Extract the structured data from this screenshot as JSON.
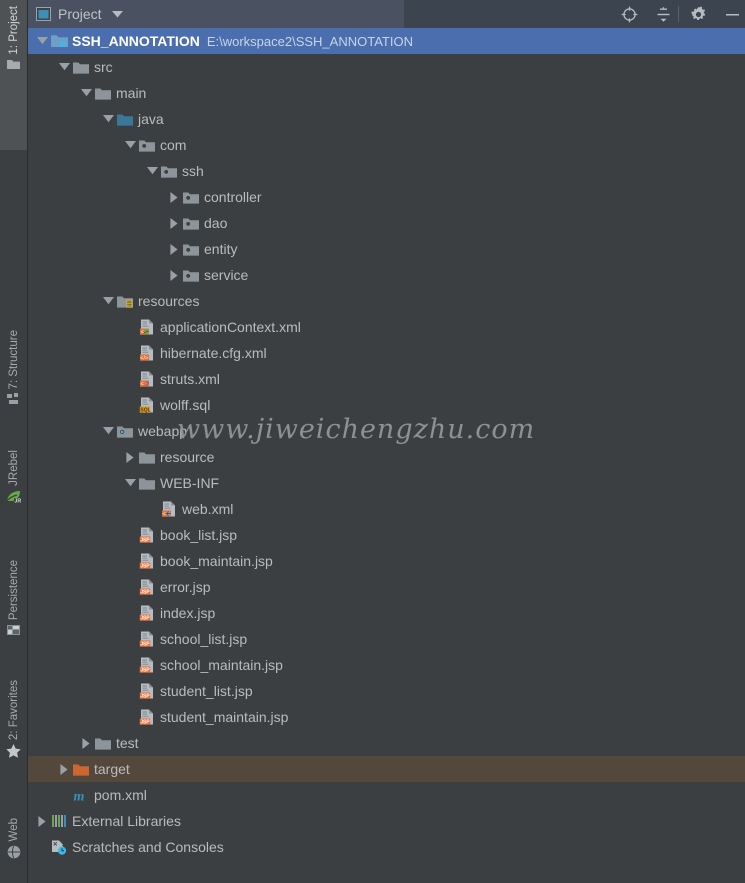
{
  "sidebar": {
    "tabs": [
      {
        "label": "1: Project",
        "icon": "project-folder-icon",
        "selected": true
      },
      {
        "label": "7: Structure",
        "icon": "structure-icon",
        "selected": false
      },
      {
        "label": "JRebel",
        "icon": "jrebel-leaf-icon",
        "selected": false
      },
      {
        "label": "Persistence",
        "icon": "persistence-icon",
        "selected": false
      },
      {
        "label": "2: Favorites",
        "icon": "star-icon",
        "selected": false
      },
      {
        "label": "Web",
        "icon": "web-globe-icon",
        "selected": false
      }
    ]
  },
  "header": {
    "title": "Project",
    "view_icon": "project-view-icon",
    "dropdown_icon": "chevron-down-icon",
    "actions": [
      {
        "name": "scroll-from-source-button",
        "icon": "crosshair-icon"
      },
      {
        "name": "collapse-all-button",
        "icon": "collapse-all-icon"
      },
      {
        "name": "settings-button",
        "icon": "gear-icon"
      },
      {
        "name": "hide-button",
        "icon": "minimize-icon"
      }
    ]
  },
  "colors": {
    "background": "#3c3f41",
    "selection": "#4b6eaf",
    "excluded_row": "#54483c",
    "header_bar": "#3c4450",
    "source_root": "#3b7798",
    "excluded_folder": "#cc6633",
    "text": "#bbbbbb"
  },
  "watermark": "www.jiweichengzhu.com",
  "tree": {
    "rows": [
      {
        "label": "SSH_ANNOTATION",
        "sub": "E:\\workspace2\\SSH_ANNOTATION",
        "depth": 0,
        "arrow": "expanded",
        "icon": "project-module-icon",
        "state": "selected"
      },
      {
        "label": "src",
        "depth": 1,
        "arrow": "expanded",
        "icon": "folder-icon"
      },
      {
        "label": "main",
        "depth": 2,
        "arrow": "expanded",
        "icon": "folder-icon"
      },
      {
        "label": "java",
        "depth": 3,
        "arrow": "expanded",
        "icon": "source-root-icon"
      },
      {
        "label": "com",
        "depth": 4,
        "arrow": "expanded",
        "icon": "package-icon"
      },
      {
        "label": "ssh",
        "depth": 5,
        "arrow": "expanded",
        "icon": "package-icon"
      },
      {
        "label": "controller",
        "depth": 6,
        "arrow": "collapsed",
        "icon": "package-icon"
      },
      {
        "label": "dao",
        "depth": 6,
        "arrow": "collapsed",
        "icon": "package-icon"
      },
      {
        "label": "entity",
        "depth": 6,
        "arrow": "collapsed",
        "icon": "package-icon"
      },
      {
        "label": "service",
        "depth": 6,
        "arrow": "collapsed",
        "icon": "package-icon"
      },
      {
        "label": "resources",
        "depth": 3,
        "arrow": "expanded",
        "icon": "resource-root-icon"
      },
      {
        "label": "applicationContext.xml",
        "depth": 4,
        "arrow": "none",
        "icon": "spring-xml-icon"
      },
      {
        "label": "hibernate.cfg.xml",
        "depth": 4,
        "arrow": "none",
        "icon": "xml-icon"
      },
      {
        "label": "struts.xml",
        "depth": 4,
        "arrow": "none",
        "icon": "struts-xml-icon"
      },
      {
        "label": "wolff.sql",
        "depth": 4,
        "arrow": "none",
        "icon": "sql-icon"
      },
      {
        "label": "webapp",
        "depth": 3,
        "arrow": "expanded",
        "icon": "web-root-icon"
      },
      {
        "label": "resource",
        "depth": 4,
        "arrow": "collapsed",
        "icon": "folder-icon"
      },
      {
        "label": "WEB-INF",
        "depth": 4,
        "arrow": "expanded",
        "icon": "folder-icon"
      },
      {
        "label": "web.xml",
        "depth": 5,
        "arrow": "none",
        "icon": "web-xml-icon"
      },
      {
        "label": "book_list.jsp",
        "depth": 4,
        "arrow": "none",
        "icon": "jsp-icon"
      },
      {
        "label": "book_maintain.jsp",
        "depth": 4,
        "arrow": "none",
        "icon": "jsp-icon"
      },
      {
        "label": "error.jsp",
        "depth": 4,
        "arrow": "none",
        "icon": "jsp-icon"
      },
      {
        "label": "index.jsp",
        "depth": 4,
        "arrow": "none",
        "icon": "jsp-icon"
      },
      {
        "label": "school_list.jsp",
        "depth": 4,
        "arrow": "none",
        "icon": "jsp-icon"
      },
      {
        "label": "school_maintain.jsp",
        "depth": 4,
        "arrow": "none",
        "icon": "jsp-icon"
      },
      {
        "label": "student_list.jsp",
        "depth": 4,
        "arrow": "none",
        "icon": "jsp-icon"
      },
      {
        "label": "student_maintain.jsp",
        "depth": 4,
        "arrow": "none",
        "icon": "jsp-icon"
      },
      {
        "label": "test",
        "depth": 2,
        "arrow": "collapsed",
        "icon": "folder-icon"
      },
      {
        "label": "target",
        "depth": 1,
        "arrow": "collapsed",
        "icon": "excluded-folder-icon",
        "state": "excluded"
      },
      {
        "label": "pom.xml",
        "depth": 1,
        "arrow": "none",
        "icon": "maven-icon"
      },
      {
        "label": "External Libraries",
        "depth": 0,
        "arrow": "collapsed",
        "icon": "libraries-icon"
      },
      {
        "label": "Scratches and Consoles",
        "depth": 0,
        "arrow": "none",
        "icon": "scratches-icon"
      }
    ]
  }
}
